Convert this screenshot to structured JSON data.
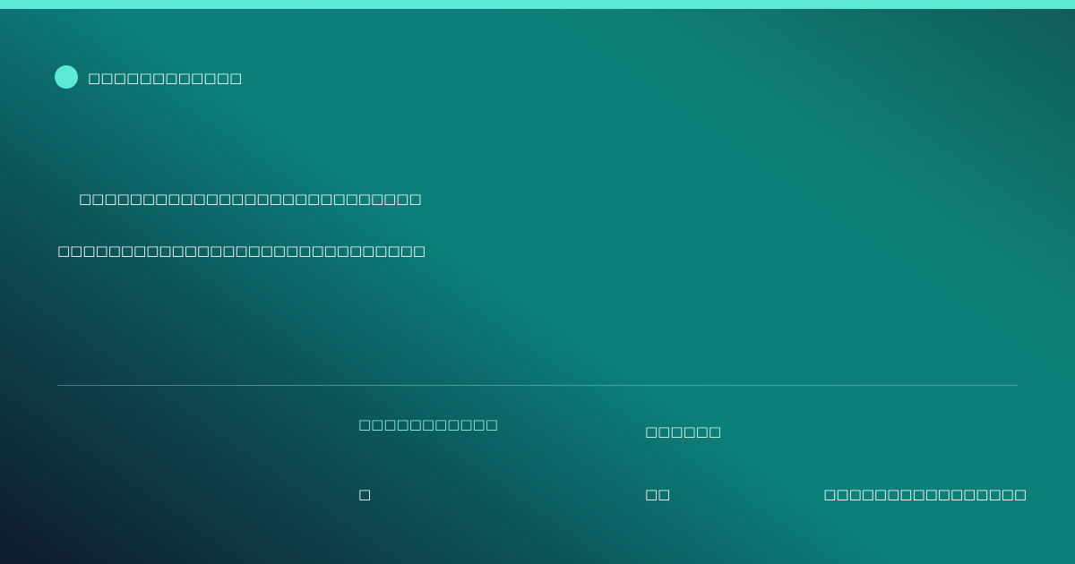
{
  "brand": {
    "label": "□□□□□□□□□□□□"
  },
  "content": {
    "line_1": "□□□□□□□□□□□□□□□□□□□□□□□□□□□",
    "line_2": "□□□□□□□□□□□□□□□□□□□□□□□□□□□□□"
  },
  "footer": {
    "heading_1": "□□□□□□□□□□□",
    "heading_2": "□□□□□□",
    "value_1": "□",
    "value_2": "□□",
    "value_3": "□□□□□□□□□□□□□□□□"
  },
  "colors": {
    "accent": "#5ee9d6",
    "background_dark": "#0f1a2e",
    "background_teal": "#0b7f79",
    "text": "#ffffff"
  }
}
